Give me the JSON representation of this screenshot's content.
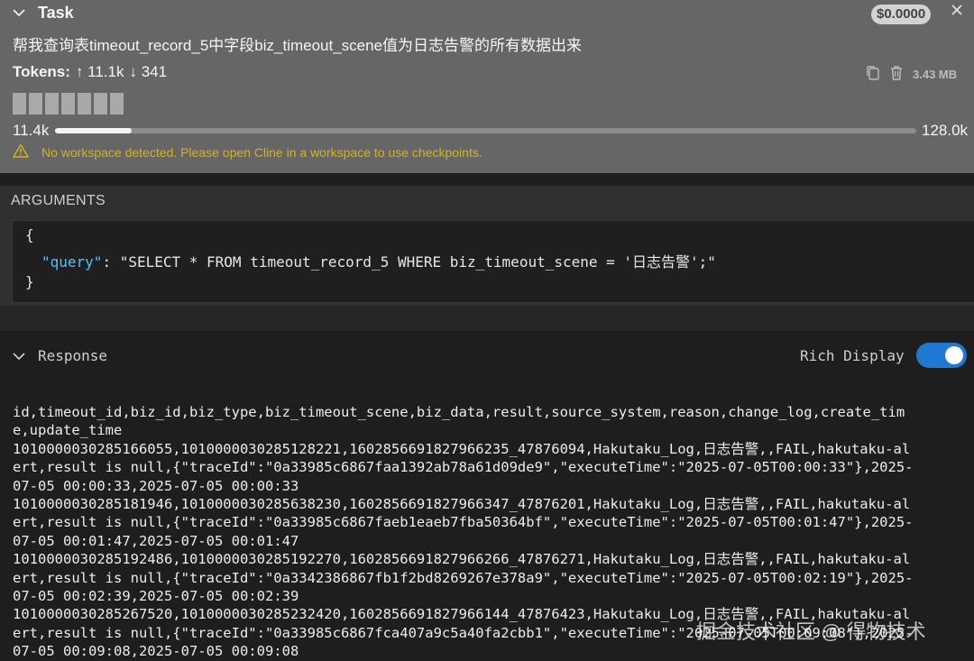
{
  "task": {
    "header_label": "Task",
    "cost": "$0.0000",
    "prompt": "帮我查询表timeout_record_5中字段biz_timeout_scene值为日志告警的所有数据出来",
    "tokens_label": "Tokens:",
    "tokens_in": "↑ 11.1k",
    "tokens_out": "↓ 341",
    "size": "3.43 MB",
    "context_used": "11.4k",
    "context_max": "128.0k",
    "context_fraction": 0.089,
    "warning": "No workspace detected. Please open Cline in a workspace to use checkpoints."
  },
  "arguments": {
    "label": "ARGUMENTS",
    "open_brace": "{",
    "key": "\"query\"",
    "colon": ": ",
    "value": "\"SELECT * FROM timeout_record_5 WHERE biz_timeout_scene = '日志告警';\"",
    "close_brace": "}"
  },
  "response": {
    "label": "Response",
    "rich_display_label": "Rich Display",
    "rich_display_on": true,
    "lines": [
      "id,timeout_id,biz_id,biz_type,biz_timeout_scene,biz_data,result,source_system,reason,change_log,create_tim",
      "e,update_time",
      "1010000030285166055,1010000030285128221,1602856691827966235_47876094,Hakutaku_Log,日志告警,,FAIL,hakutaku-al",
      "ert,result is null,{\"traceId\":\"0a33985c6867faa1392ab78a61d09de9\",\"executeTime\":\"2025-07-05T00:00:33\"},2025-",
      "07-05 00:00:33,2025-07-05 00:00:33",
      "1010000030285181946,1010000030285638230,1602856691827966347_47876201,Hakutaku_Log,日志告警,,FAIL,hakutaku-al",
      "ert,result is null,{\"traceId\":\"0a33985c6867faeb1eaeb7fba50364bf\",\"executeTime\":\"2025-07-05T00:01:47\"},2025-",
      "07-05 00:01:47,2025-07-05 00:01:47",
      "1010000030285192486,1010000030285192270,1602856691827966266_47876271,Hakutaku_Log,日志告警,,FAIL,hakutaku-al",
      "ert,result is null,{\"traceId\":\"0a3342386867fb1f2bd8269267e378a9\",\"executeTime\":\"2025-07-05T00:02:19\"},2025-",
      "07-05 00:02:39,2025-07-05 00:02:39",
      "1010000030285267520,1010000030285232420,1602856691827966144_47876423,Hakutaku_Log,日志告警,,FAIL,hakutaku-al",
      "ert,result is null,{\"traceId\":\"0a33985c6867fca407a9c5a40fa2cbb1\",\"executeTime\":\"2025-07-05T00:09:08\"},2025-",
      "07-05 00:09:08,2025-07-05 00:09:08"
    ]
  },
  "watermark": "掘金技术社区 @ 得物技术",
  "colors": {
    "accent": "#1f78d1",
    "warning": "#d4b21e",
    "json_key": "#4fc1ff"
  },
  "icons": [
    "chevron-down-icon",
    "close-icon",
    "copy-icon",
    "trash-icon",
    "warning-icon"
  ]
}
